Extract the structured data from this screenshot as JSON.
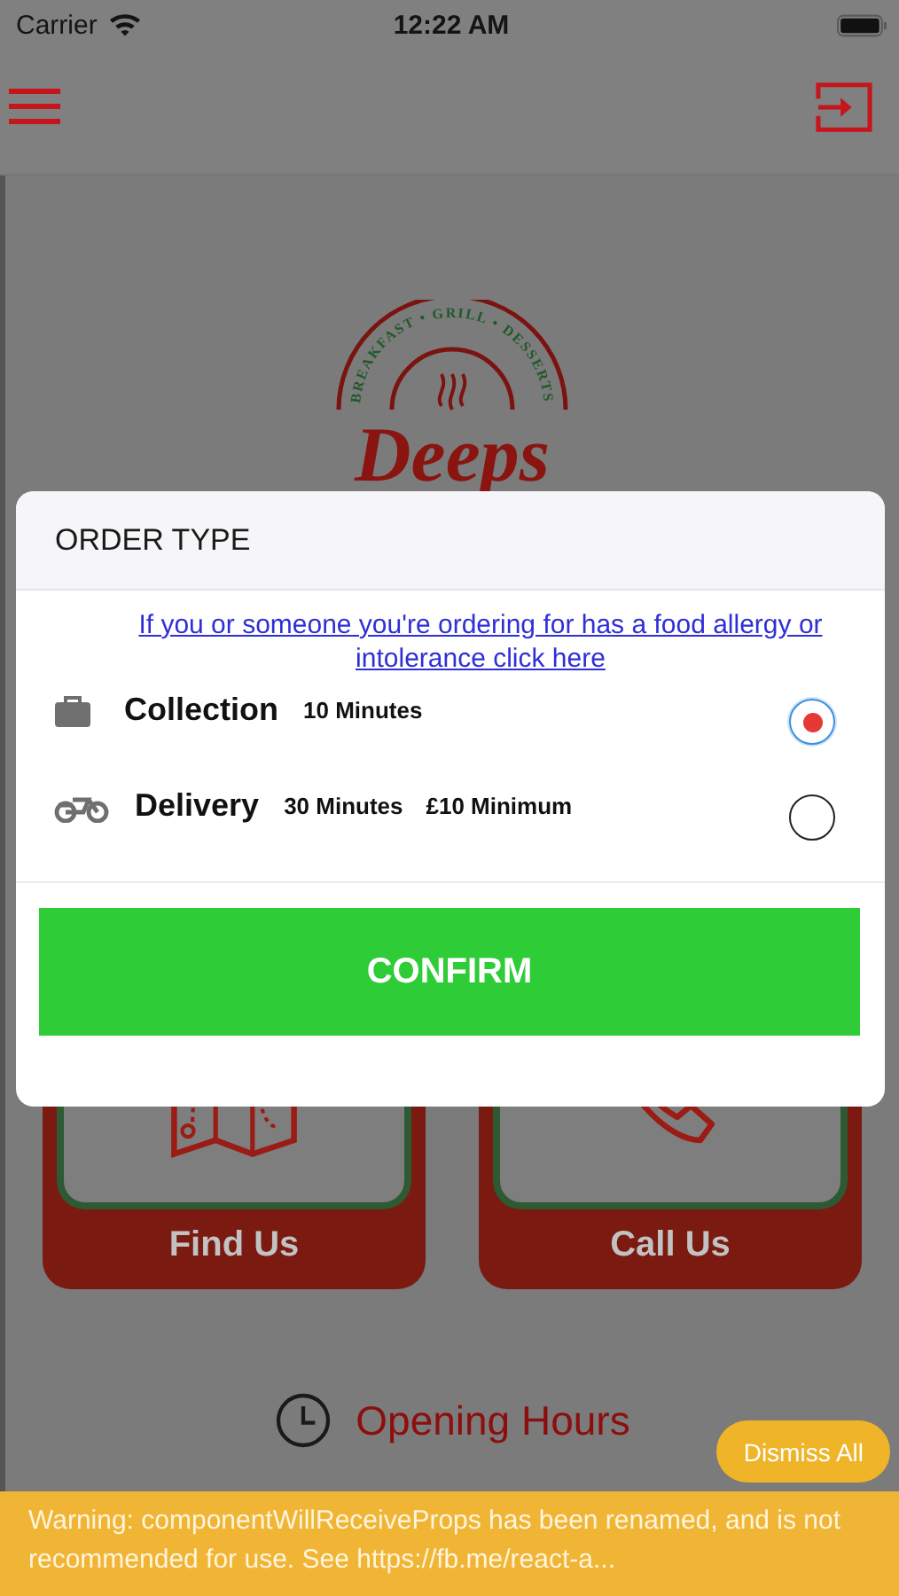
{
  "status_bar": {
    "carrier": "Carrier",
    "time": "12:22 AM"
  },
  "logo": {
    "tagline": "BREAKFAST • GRILL • DESSERTS",
    "name": "Deeps"
  },
  "tiles": [
    {
      "kind": "map",
      "label": "Find Us"
    },
    {
      "kind": "phone",
      "label": "Call Us"
    }
  ],
  "opening_hours": "Opening Hours",
  "dialog": {
    "title": "ORDER TYPE",
    "allergy_link": "If you or someone you're ordering for has a food allergy or intolerance click here",
    "options": [
      {
        "kind": "collection",
        "label": "Collection",
        "details": [
          "10 Minutes"
        ],
        "selected": true
      },
      {
        "kind": "delivery",
        "label": "Delivery",
        "details": [
          "30 Minutes",
          "£10 Minimum"
        ],
        "selected": false
      }
    ],
    "confirm": "CONFIRM"
  },
  "dismiss_all": "Dismiss All",
  "warning": "Warning: componentWillReceiveProps has been renamed, and is not recommended for use. See https://fb.me/react-a..."
}
